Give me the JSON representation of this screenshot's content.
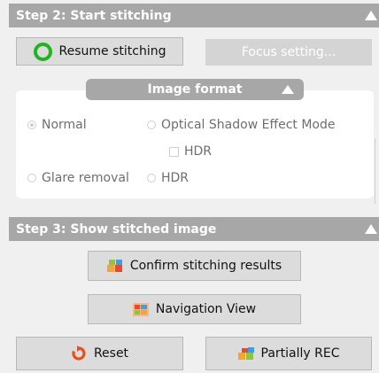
{
  "step2": {
    "title": "Step 2: Start stitching",
    "resume_label": "Resume stitching",
    "focus_label": "Focus setting..."
  },
  "image_format": {
    "title": "Image format",
    "options": {
      "normal": "Normal",
      "optical_shadow": "Optical Shadow Effect Mode",
      "hdr_check": "HDR",
      "glare_removal": "Glare removal",
      "hdr": "HDR"
    },
    "selected": "Normal"
  },
  "step3": {
    "title": "Step 3: Show stitched image",
    "confirm_label": "Confirm stitching results",
    "navigation_label": "Navigation View",
    "reset_label": "Reset",
    "partial_rec_label": "Partially REC"
  },
  "colors": {
    "header_bg": "#a7a7a7",
    "resume_ring": "#23b320",
    "reset_icon": "#ef4c18"
  }
}
